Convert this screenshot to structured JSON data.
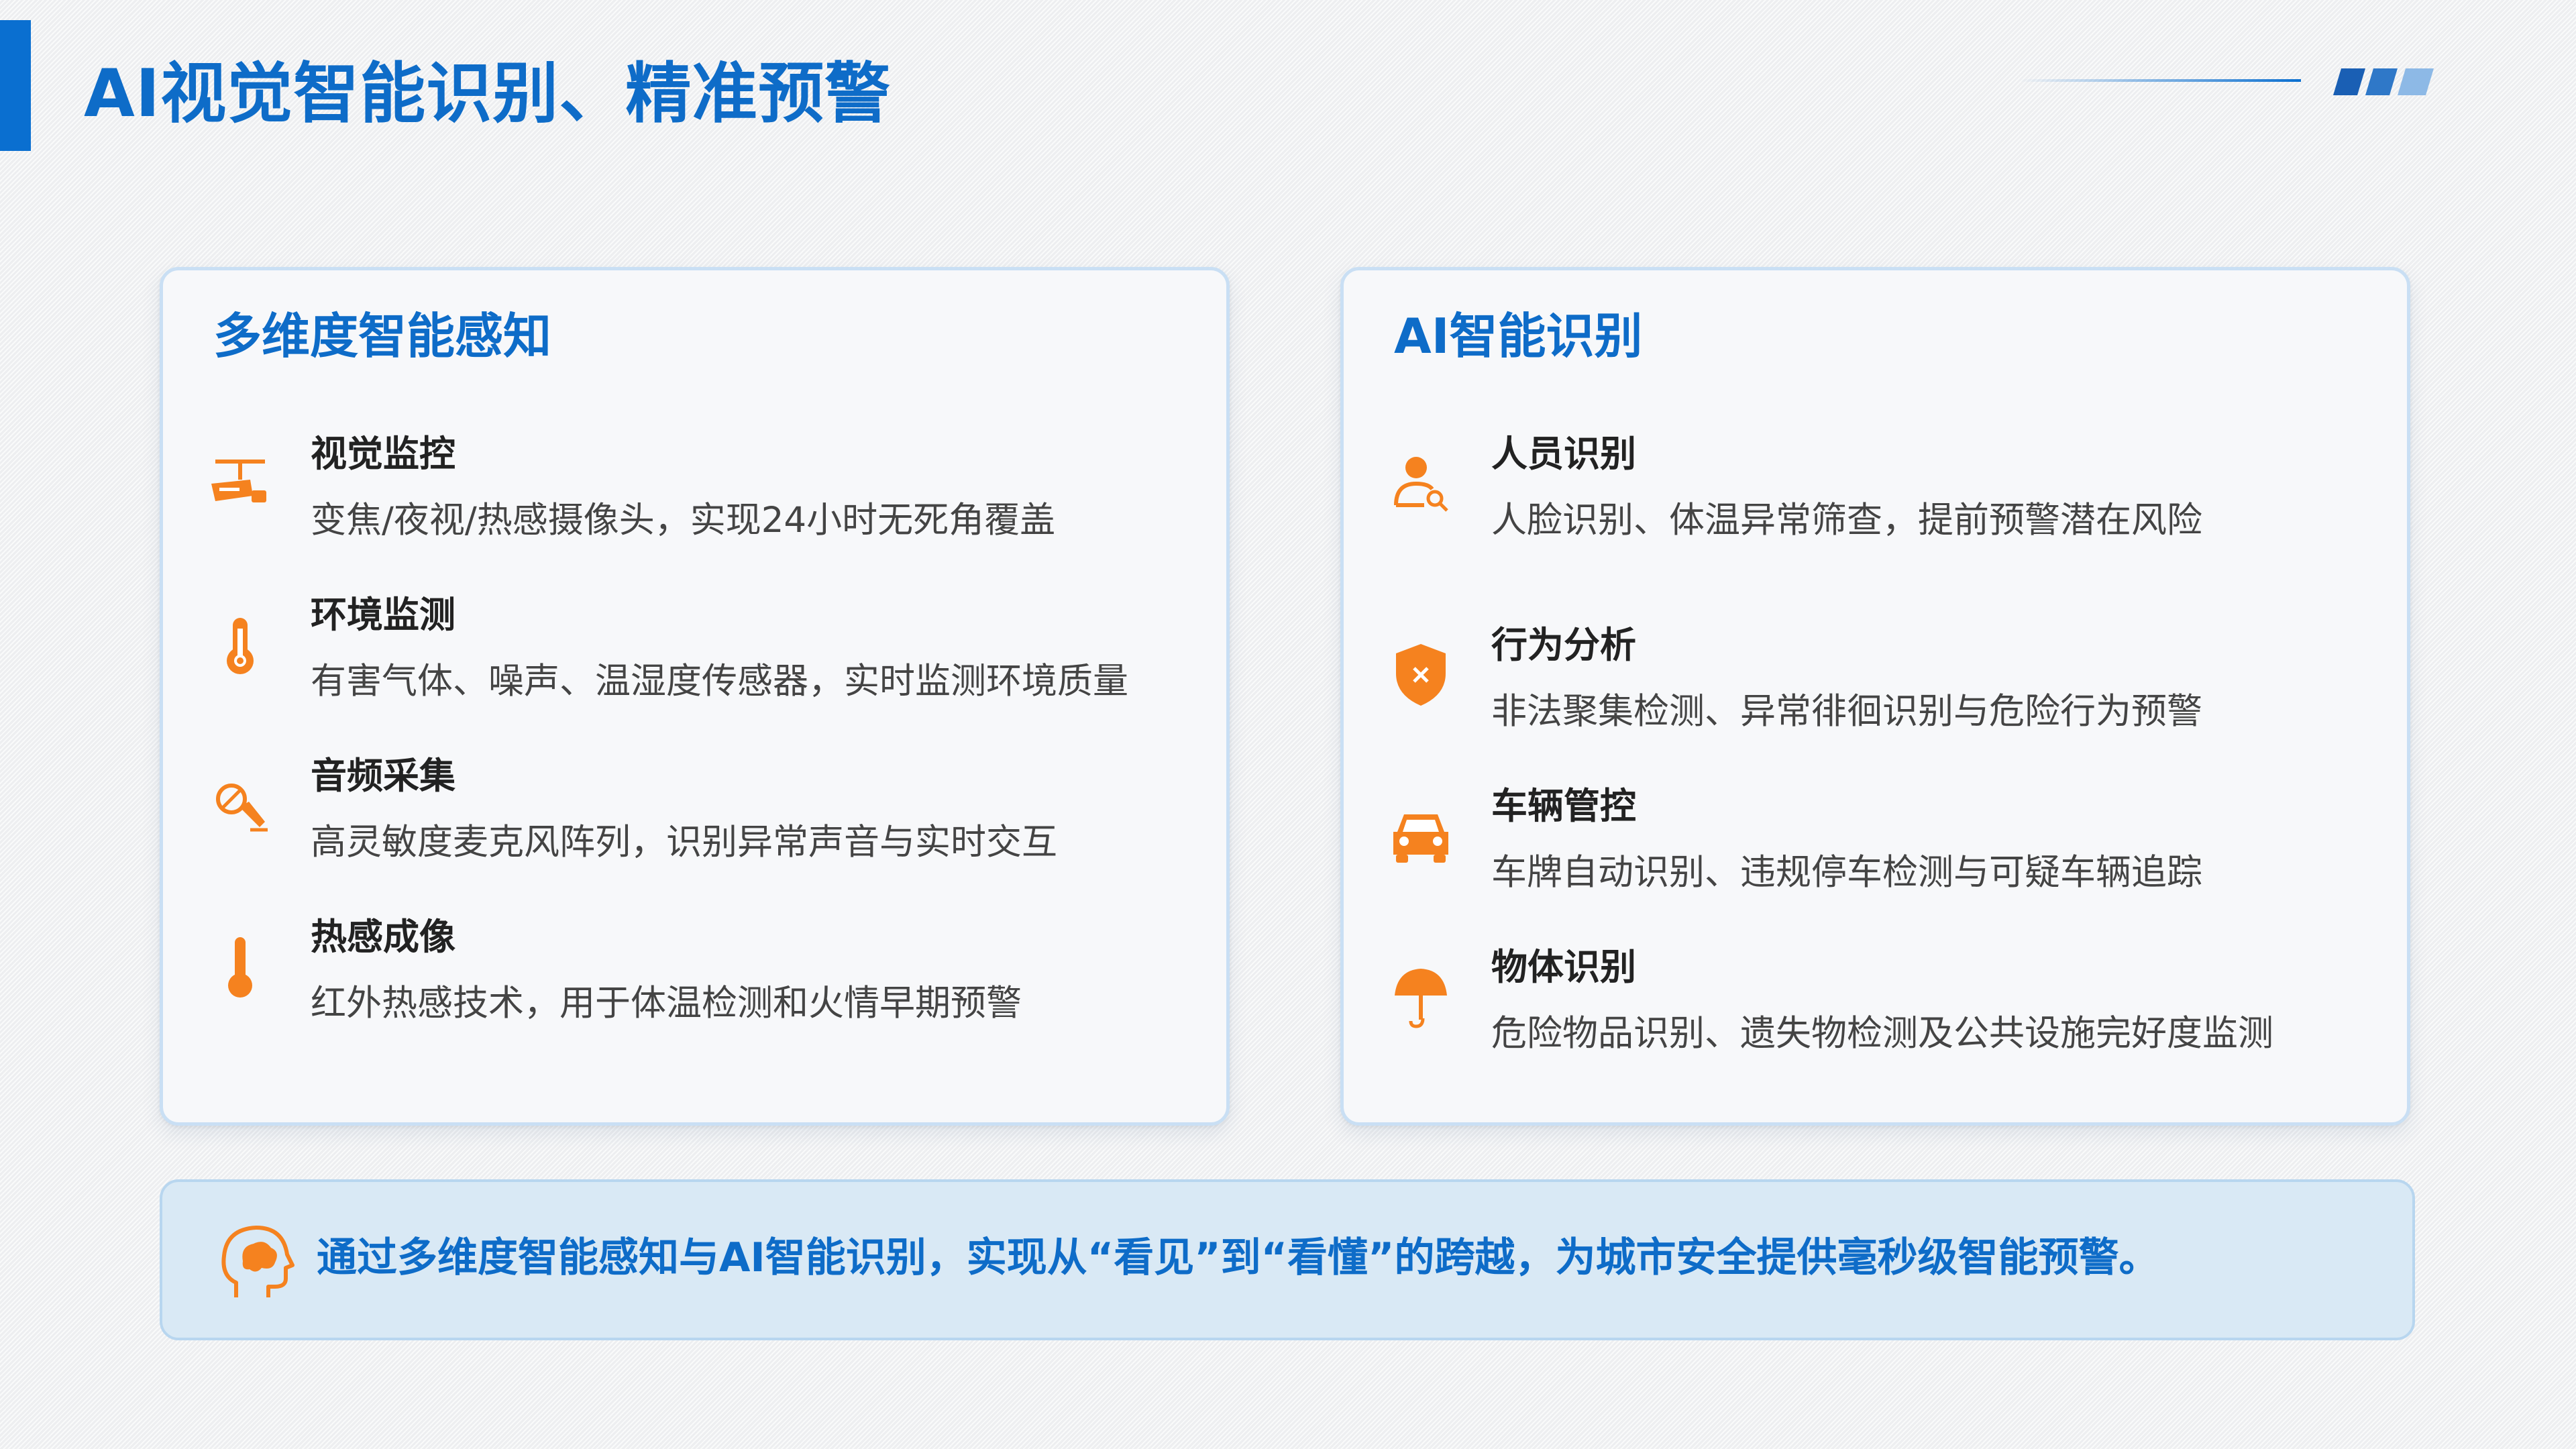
{
  "page": {
    "title": "AI视觉智能识别、精准预警"
  },
  "colors": {
    "primary": "#0e6cc8",
    "accent": "#f5821f",
    "card_bg": "#f7f8fa",
    "summary_bg": "#d9e9f5"
  },
  "left_card": {
    "title": "多维度智能感知",
    "items": [
      {
        "icon": "surveillance-camera-icon",
        "title": "视觉监控",
        "desc": "变焦/夜视/热感摄像头，实现24小时无死角覆盖"
      },
      {
        "icon": "thermometer-icon",
        "title": "环境监测",
        "desc": "有害气体、噪声、温湿度传感器，实时监测环境质量"
      },
      {
        "icon": "microphone-icon",
        "title": "音频采集",
        "desc": "高灵敏度麦克风阵列，识别异常声音与实时交互"
      },
      {
        "icon": "thermal-imaging-icon",
        "title": "热感成像",
        "desc": "红外热感技术，用于体温检测和火情早期预警"
      }
    ]
  },
  "right_card": {
    "title": "AI智能识别",
    "items": [
      {
        "icon": "person-search-icon",
        "title": "人员识别",
        "desc": "人脸识别、体温异常筛查，提前预警潜在风险"
      },
      {
        "icon": "shield-alert-icon",
        "title": "行为分析",
        "desc": "非法聚集检测、异常徘徊识别与危险行为预警"
      },
      {
        "icon": "car-icon",
        "title": "车辆管控",
        "desc": "车牌自动识别、违规停车检测与可疑车辆追踪"
      },
      {
        "icon": "umbrella-icon",
        "title": "物体识别",
        "desc": "危险物品识别、遗失物检测及公共设施完好度监测"
      }
    ]
  },
  "summary": {
    "icon": "brain-head-icon",
    "text": "通过多维度智能感知与AI智能识别，实现从“看见”到“看懂”的跨越，为城市安全提供毫秒级智能预警。"
  }
}
